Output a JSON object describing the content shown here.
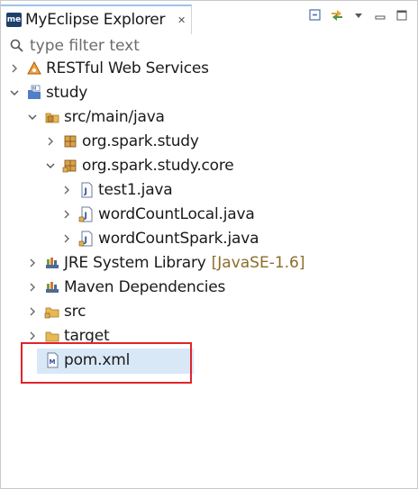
{
  "view": {
    "title": "MyEclipse Explorer",
    "close_glyph": "✕",
    "toolbar": [
      "collapse-all-icon",
      "link-with-editor-icon",
      "view-menu-icon",
      "minimize-icon",
      "maximize-icon"
    ]
  },
  "filter": {
    "placeholder": "type filter text"
  },
  "tree": {
    "restful": "RESTful Web Services",
    "study": "study",
    "src_main_java": "src/main/java",
    "pkg_study": "org.spark.study",
    "pkg_core": "org.spark.study.core",
    "file_test1": "test1.java",
    "file_wcl": "wordCountLocal.java",
    "file_wcs": "wordCountSpark.java",
    "jre": "JRE System Library",
    "jre_decor": "[JavaSE-1.6]",
    "maven": "Maven Dependencies",
    "src": "src",
    "target": "target",
    "pom": "pom.xml"
  },
  "colors": {
    "selection": "#d9e8f7",
    "annotation": "#e0242b",
    "decoration": "#8b6d2b"
  }
}
